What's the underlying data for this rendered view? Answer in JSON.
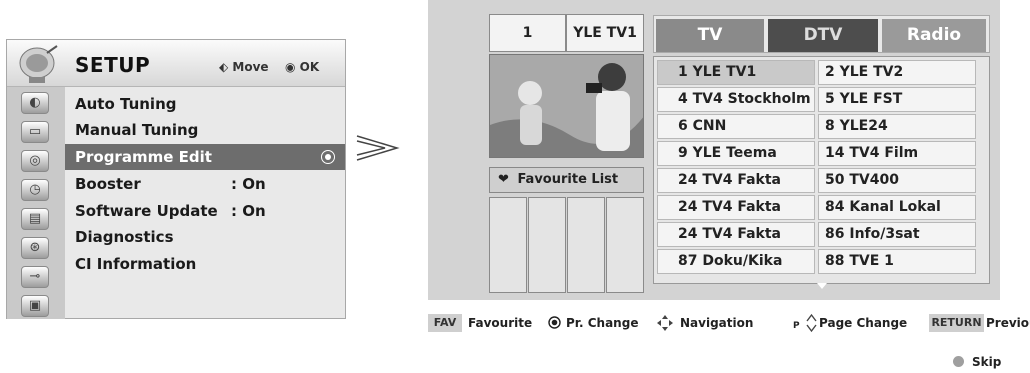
{
  "setup": {
    "title": "SETUP",
    "hint_move": "Move",
    "hint_ok": "OK",
    "icons": [
      "satellite-dish-icon",
      "picture-icon",
      "audio-icon",
      "clock-icon",
      "option-icon",
      "lock-icon",
      "input-icon",
      "usb-icon"
    ],
    "items": [
      {
        "label": "Auto Tuning",
        "value": ""
      },
      {
        "label": "Manual Tuning",
        "value": ""
      },
      {
        "label": "Programme Edit",
        "value": "",
        "selected": true
      },
      {
        "label": "Booster",
        "value": ": On"
      },
      {
        "label": "Software Update",
        "value": ": On"
      },
      {
        "label": "Diagnostics",
        "value": ""
      },
      {
        "label": "CI Information",
        "value": ""
      }
    ]
  },
  "edit": {
    "current_number": "1",
    "current_name": "YLE TV1",
    "favourite_label": "Favourite List",
    "tabs": [
      "TV",
      "DTV",
      "Radio"
    ],
    "active_tab": "DTV",
    "channels_left": [
      "1 YLE TV1",
      "4 TV4 Stockholm",
      "6 CNN",
      "9 YLE Teema",
      "24 TV4 Fakta",
      "24 TV4 Fakta",
      "24 TV4 Fakta",
      "87 Doku/Kika"
    ],
    "channels_right": [
      "2 YLE TV2",
      "5 YLE FST",
      "8 YLE24",
      "14 TV4 Film",
      "50 TV400",
      "84 Kanal Lokal",
      "86 Info/3sat",
      "88 TVE 1"
    ]
  },
  "footer": {
    "fav_key": "FAV",
    "fav_label": "Favourite",
    "pr_change": "Pr. Change",
    "navigation": "Navigation",
    "page_key": "P",
    "page_change": "Page Change",
    "return_key": "RETURN",
    "return_label": "Previous",
    "skip": "Skip"
  },
  "colors": {
    "selected_row": "#6d6d6d",
    "active_tab": "#4d4d4d",
    "panel_bg": "#d3d3d3"
  }
}
